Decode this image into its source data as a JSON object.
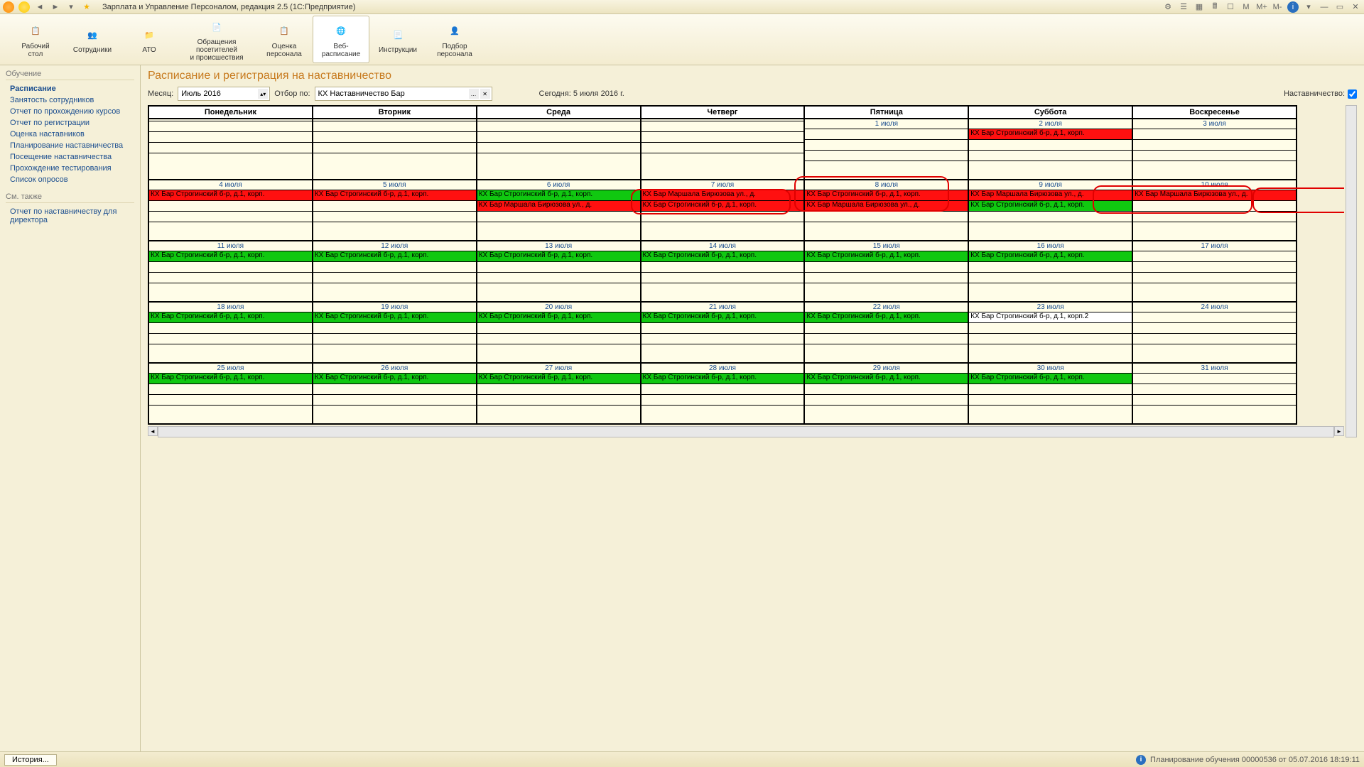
{
  "title": "Зарплата и Управление Персоналом, редакция 2.5  (1С:Предприятие)",
  "titlebar_right": [
    "M",
    "M+",
    "M-"
  ],
  "toolbar": [
    {
      "label": "Рабочий\nстол"
    },
    {
      "label": "Сотрудники"
    },
    {
      "label": "АТО"
    },
    {
      "label": "Обращения посетителей\nи происшествия"
    },
    {
      "label": "Оценка\nперсонала"
    },
    {
      "label": "Веб-расписание"
    },
    {
      "label": "Инструкции"
    },
    {
      "label": "Подбор\nперсонала"
    }
  ],
  "sidebar": {
    "section1": "Обучение",
    "links1": [
      "Расписание",
      "Занятость сотрудников",
      "Отчет по прохождению курсов",
      "Отчет по регистрации",
      "Оценка наставников",
      "Планирование наставничества",
      "Посещение наставничества",
      "Прохождение тестирования",
      "Список опросов"
    ],
    "section2": "См. также",
    "links2": [
      "Отчет по наставничеству для директора"
    ]
  },
  "page_title": "Расписание и регистрация на наставничество",
  "filters": {
    "month_label": "Месяц:",
    "month_value": "Июль 2016",
    "filter_label": "Отбор по:",
    "filter_value": "КХ Наставничество Бар",
    "today": "Сегодня: 5 июля 2016 г.",
    "mentor_label": "Наставничество:"
  },
  "days_header": [
    "Понедельник",
    "Вторник",
    "Среда",
    "Четверг",
    "Пятница",
    "Суббота",
    "Воскресенье"
  ],
  "cell_text": {
    "stroginsky": "КХ Бар Строгинский б-р, д.1, корп.",
    "biryuzova": "КХ Бар Маршала Бирюзова ул., д.",
    "stroginsky_plain": "КХ Бар Строгинский б-р, д.1, корп.2"
  },
  "side_num": "16",
  "weeks": [
    {
      "dates": [
        "",
        "",
        "",
        "",
        "1 июля",
        "2 июля",
        "3 июля"
      ],
      "events": {
        "5": [
          {
            "c": "red",
            "t": "stroginsky"
          }
        ]
      }
    },
    {
      "dates": [
        "4 июля",
        "5 июля",
        "6 июля",
        "7 июля",
        "8 июля",
        "9 июля",
        "10 июля"
      ],
      "events": {
        "0": [
          {
            "c": "red",
            "t": "stroginsky"
          }
        ],
        "1": [
          {
            "c": "red",
            "t": "stroginsky"
          }
        ],
        "2": [
          {
            "c": "green",
            "t": "stroginsky"
          },
          {
            "c": "red",
            "t": "biryuzova"
          }
        ],
        "3": [
          {
            "c": "red",
            "t": "biryuzova"
          },
          {
            "c": "red",
            "t": "stroginsky"
          }
        ],
        "4": [
          {
            "c": "red",
            "t": "stroginsky"
          },
          {
            "c": "red",
            "t": "biryuzova"
          }
        ],
        "5": [
          {
            "c": "red",
            "t": "biryuzova"
          },
          {
            "c": "green",
            "t": "stroginsky"
          }
        ],
        "6": [
          {
            "c": "red",
            "t": "biryuzova"
          }
        ]
      }
    },
    {
      "dates": [
        "11 июля",
        "12 июля",
        "13 июля",
        "14 июля",
        "15 июля",
        "16 июля",
        "17 июля"
      ],
      "events": {
        "0": [
          {
            "c": "green",
            "t": "stroginsky"
          }
        ],
        "1": [
          {
            "c": "green",
            "t": "stroginsky"
          }
        ],
        "2": [
          {
            "c": "green",
            "t": "stroginsky"
          }
        ],
        "3": [
          {
            "c": "green",
            "t": "stroginsky"
          }
        ],
        "4": [
          {
            "c": "green",
            "t": "stroginsky"
          }
        ],
        "5": [
          {
            "c": "green",
            "t": "stroginsky"
          }
        ]
      }
    },
    {
      "dates": [
        "18 июля",
        "19 июля",
        "20 июля",
        "21 июля",
        "22 июля",
        "23 июля",
        "24 июля"
      ],
      "events": {
        "0": [
          {
            "c": "green",
            "t": "stroginsky"
          }
        ],
        "1": [
          {
            "c": "green",
            "t": "stroginsky"
          }
        ],
        "2": [
          {
            "c": "green",
            "t": "stroginsky"
          }
        ],
        "3": [
          {
            "c": "green",
            "t": "stroginsky"
          }
        ],
        "4": [
          {
            "c": "green",
            "t": "stroginsky"
          }
        ],
        "5": [
          {
            "c": "plain",
            "t": "stroginsky_plain"
          }
        ]
      }
    },
    {
      "dates": [
        "25 июля",
        "26 июля",
        "27 июля",
        "28 июля",
        "29 июля",
        "30 июля",
        "31 июля"
      ],
      "events": {
        "0": [
          {
            "c": "green",
            "t": "stroginsky"
          }
        ],
        "1": [
          {
            "c": "green",
            "t": "stroginsky"
          }
        ],
        "2": [
          {
            "c": "green",
            "t": "stroginsky"
          }
        ],
        "3": [
          {
            "c": "green",
            "t": "stroginsky"
          }
        ],
        "4": [
          {
            "c": "green",
            "t": "stroginsky"
          }
        ],
        "5": [
          {
            "c": "green",
            "t": "stroginsky"
          }
        ]
      }
    }
  ],
  "statusbar": {
    "history": "История...",
    "right": "Планирование обучения 00000536 от 05.07.2016 18:19:11"
  }
}
